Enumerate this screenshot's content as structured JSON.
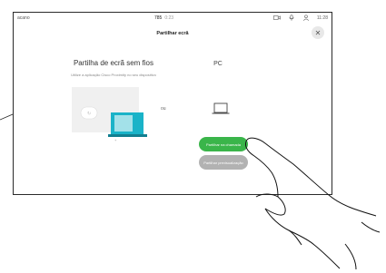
{
  "status": {
    "left": "acano",
    "number": "785",
    "number_suffix": "0:23",
    "time": "11:28"
  },
  "header": {
    "title": "Partilhar ecrã"
  },
  "wireless": {
    "title": "Partilha de ecrã sem fios",
    "subtitle": "Utilize a aplicação Cisco Proximity no seu dispositivo"
  },
  "separator": "ou",
  "pc": {
    "title": "PC"
  },
  "buttons": {
    "primary_label": "Partilhar na chamada",
    "secondary_label": "Partilhar previsualização"
  },
  "colors": {
    "accent_green": "#3ab54a",
    "secondary_grey": "#b2b2b2",
    "laptop_cyan": "#1ab3c8"
  },
  "icons": [
    "camera-icon",
    "microphone-icon",
    "person-icon",
    "close-icon",
    "laptop-icon"
  ]
}
